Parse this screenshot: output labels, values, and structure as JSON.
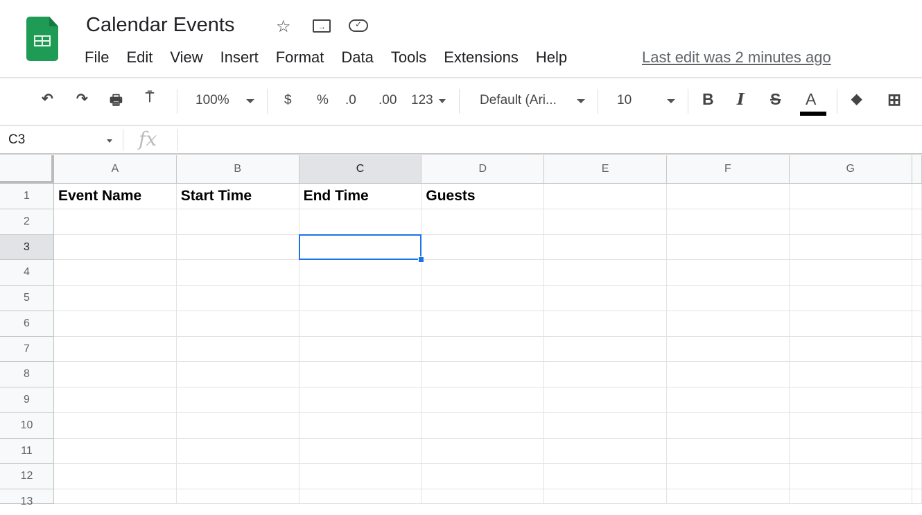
{
  "app": {
    "title": "Calendar Events",
    "last_edit": "Last edit was 2 minutes ago"
  },
  "menu": [
    "File",
    "Edit",
    "View",
    "Insert",
    "Format",
    "Data",
    "Tools",
    "Extensions",
    "Help"
  ],
  "toolbar": {
    "zoom": "100%",
    "currency": "$",
    "percent": "%",
    "dec_decrease": ".0",
    "dec_increase": ".00",
    "more_formats": "123",
    "font": "Default (Ari...",
    "font_size": "10",
    "bold": "B",
    "italic": "I",
    "strike": "S",
    "text_color": "A",
    "text_color_value": "#000000"
  },
  "formula_bar": {
    "name_box": "C3",
    "fx": "fx",
    "value": ""
  },
  "grid": {
    "columns": [
      "A",
      "B",
      "C",
      "D",
      "E",
      "F",
      "G"
    ],
    "rows": [
      "1",
      "2",
      "3",
      "4",
      "5",
      "6",
      "7",
      "8",
      "9",
      "10",
      "11",
      "12",
      "13"
    ],
    "cells": {
      "A1": "Event Name",
      "B1": "Start Time",
      "C1": "End Time",
      "D1": "Guests"
    },
    "selected": "C3"
  },
  "colors": {
    "brand": "#1e9c56",
    "selection": "#1a73e8"
  }
}
